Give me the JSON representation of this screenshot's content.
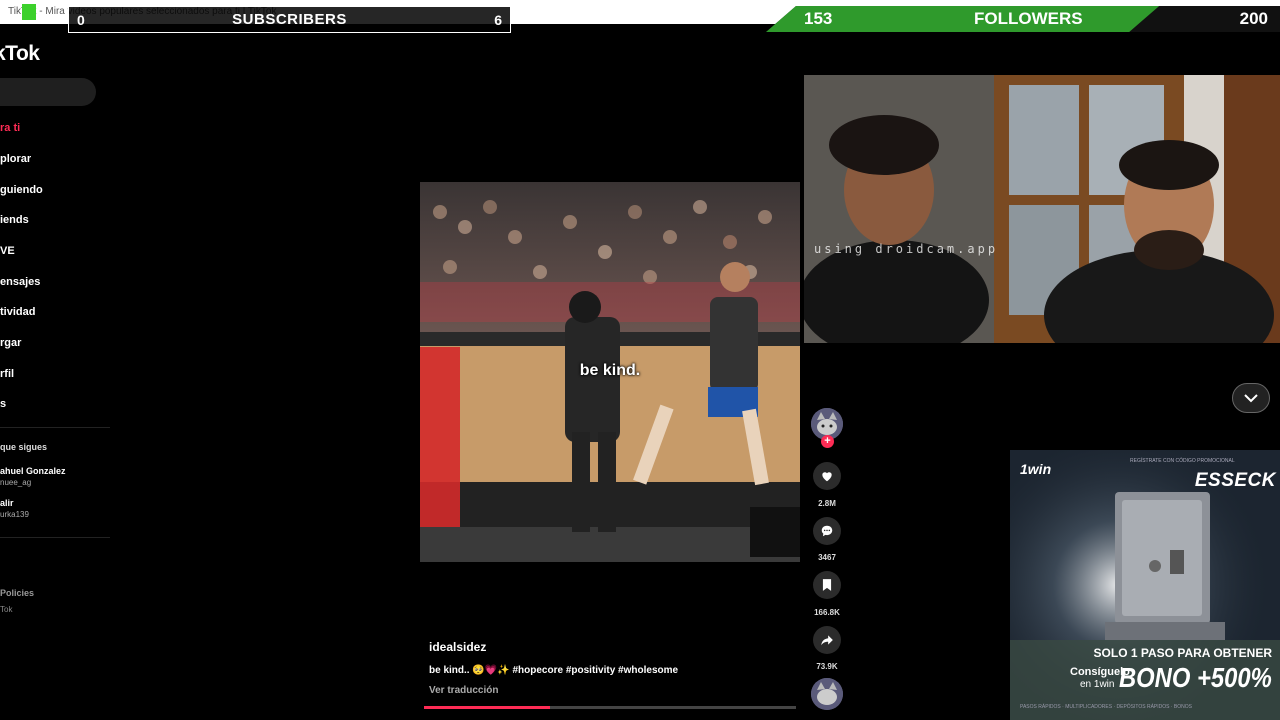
{
  "window": {
    "title": "TikTok - Mira videos populares seleccionados para ti | TikTok",
    "controls": [
      "–",
      "▢",
      "✕"
    ]
  },
  "overlays": {
    "subscribers": {
      "label": "SUBSCRIBERS",
      "current": "0",
      "goal": "6",
      "progress": 0
    },
    "followers": {
      "label": "FOLLOWERS",
      "current": "153",
      "goal": "200",
      "progress": 0.765
    }
  },
  "sidebar": {
    "logo": "kTok",
    "nav": [
      {
        "label": "ra ti",
        "active": true
      },
      {
        "label": "plorar",
        "active": false
      },
      {
        "label": "guiendo",
        "active": false
      },
      {
        "label": "iends",
        "active": false
      },
      {
        "label": "VE",
        "active": false
      },
      {
        "label": "ensajes",
        "active": false
      },
      {
        "label": "tividad",
        "active": false
      },
      {
        "label": "rgar",
        "active": false
      },
      {
        "label": "rfil",
        "active": false
      },
      {
        "label": "s",
        "active": false
      }
    ],
    "following_title": "que sigues",
    "accounts": [
      {
        "name": "ahuel Gonzalez",
        "handle": "nuee_ag"
      },
      {
        "name": "alir",
        "handle": "urka139"
      }
    ],
    "footer": [
      "Policies",
      "Tok"
    ]
  },
  "video": {
    "overlay_text": "be kind.",
    "author": "idealsidez",
    "description": "be kind.. 🥺💗✨ #hopecore #positivity #wholesome",
    "translate_label": "Ver traducción",
    "progress": 0.34
  },
  "actions": {
    "likes": "2.8M",
    "comments": "3467",
    "saves": "166.8K",
    "shares": "73.9K"
  },
  "webcam": {
    "watermark": "using droidcam.app"
  },
  "ad": {
    "logo": "1win",
    "brand": "ESSECK",
    "tagline": "REGÍSTRATE CON CÓDIGO PROMOCIONAL",
    "cta_line1": "SOLO 1 PASO PARA OBTENER",
    "cta_line2": "BONO +500%",
    "get_line1": "Consíguelo",
    "get_line2": "en 1win",
    "steps": "PASOS RÁPIDOS · MULTIPLICADORES · DEPÓSITOS RÁPIDOS · BONOS"
  },
  "colors": {
    "accent": "#fe2c55",
    "followers_bar": "#2f9a2c",
    "tiktok_bg": "#000000"
  }
}
